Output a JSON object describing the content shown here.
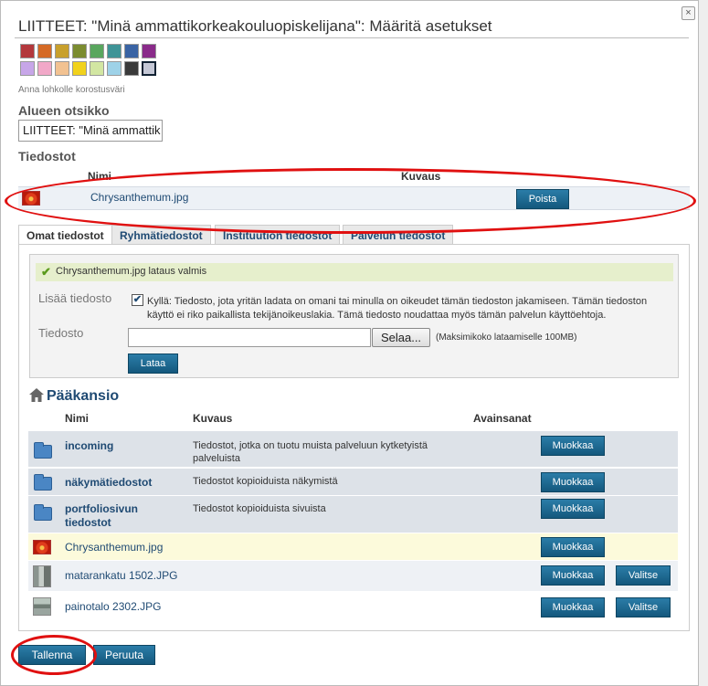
{
  "dialog": {
    "title": "LIITTEET: \"Minä ammattikorkeakouluopiskelijana\": Määritä asetukset",
    "close_label": "×"
  },
  "colors": {
    "swatches": [
      "#b3383c",
      "#d56a26",
      "#c8a02c",
      "#7b8c30",
      "#59a65e",
      "#3f9497",
      "#3a64a4",
      "#8a2b8a",
      "#c7a6e8",
      "#f1a8c8",
      "#f2c291",
      "#f1d21c",
      "#d2e6a2",
      "#9ed2e8",
      "#3a3a3a",
      "#c5c8d6"
    ],
    "selected_index": 15,
    "hint": "Anna lohkolle korostusväri",
    "accent": "#1f4a73",
    "button": "#1b6a93",
    "highlight_oval": "#e01010"
  },
  "area": {
    "label": "Alueen otsikko",
    "value": "LIITTEET: \"Minä ammattik"
  },
  "attached_files": {
    "label": "Tiedostot",
    "headers": {
      "name": "Nimi",
      "description": "Kuvaus"
    },
    "rows": [
      {
        "icon": "flower-thumbnail-icon",
        "name": "Chrysanthemum.jpg",
        "action": "Poista"
      }
    ]
  },
  "tabs": [
    {
      "label": "Omat tiedostot",
      "active": true
    },
    {
      "label": "Ryhmätiedostot",
      "active": false
    },
    {
      "label": "Instituution tiedostot",
      "active": false
    },
    {
      "label": "Palvelun tiedostot",
      "active": false
    }
  ],
  "upload": {
    "success_message": "Chrysanthemum.jpg lataus valmis",
    "add_files_label": "Lisää tiedosto",
    "consent_checked": true,
    "consent_text": "Kyllä: Tiedosto, jota yritän ladata on omani tai minulla on oikeudet tämän tiedoston jakamiseen. Tämän tiedoston käyttö ei riko paikallista tekijänoikeuslakia. Tämä tiedosto noudattaa myös tämän palvelun käyttöehtoja.",
    "file_label": "Tiedosto",
    "file_value": "",
    "browse_label": "Selaa...",
    "max_size": "(Maksimikoko lataamiselle 100MB)",
    "upload_button": "Lataa"
  },
  "folder": {
    "title": "Pääkansio",
    "headers": {
      "name": "Nimi",
      "description": "Kuvaus",
      "tags": "Avainsanat"
    },
    "rows": [
      {
        "type": "folder",
        "name": "incoming",
        "description": "Tiedostot, jotka on tuotu muista palveluun kytketyistä palveluista",
        "edit": "Muokkaa",
        "select": ""
      },
      {
        "type": "folder",
        "name": "näkymätiedostot",
        "description": "Tiedostot kopioiduista näkymistä",
        "edit": "Muokkaa",
        "select": ""
      },
      {
        "type": "folder",
        "name": "portfoliosivun tiedostot",
        "description": "Tiedostot kopioiduista sivuista",
        "edit": "Muokkaa",
        "select": ""
      },
      {
        "type": "image",
        "name": "Chrysanthemum.jpg",
        "description": "",
        "edit": "Muokkaa",
        "select": ""
      },
      {
        "type": "image",
        "name": "matarankatu 1502.JPG",
        "description": "",
        "edit": "Muokkaa",
        "select": "Valitse"
      },
      {
        "type": "image",
        "name": "painotalo 2302.JPG",
        "description": "",
        "edit": "Muokkaa",
        "select": "Valitse"
      }
    ]
  },
  "footer": {
    "save": "Tallenna",
    "cancel": "Peruuta"
  }
}
